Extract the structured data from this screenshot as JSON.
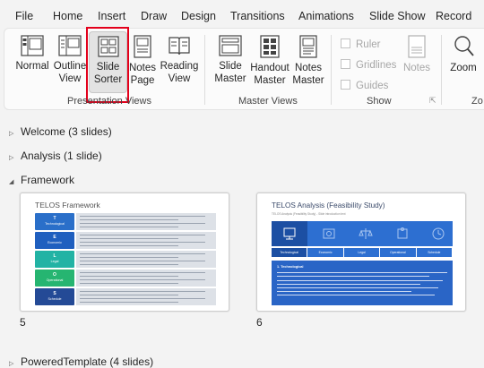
{
  "menu": [
    "File",
    "Home",
    "Insert",
    "Draw",
    "Design",
    "Transitions",
    "Animations",
    "Slide Show",
    "Record"
  ],
  "ribbon": {
    "presentation_views": {
      "label": "Presentation Views",
      "buttons": [
        {
          "line1": "Normal",
          "line2": ""
        },
        {
          "line1": "Outline",
          "line2": "View"
        },
        {
          "line1": "Slide",
          "line2": "Sorter"
        },
        {
          "line1": "Notes",
          "line2": "Page"
        },
        {
          "line1": "Reading",
          "line2": "View"
        }
      ]
    },
    "master_views": {
      "label": "Master Views",
      "buttons": [
        {
          "line1": "Slide",
          "line2": "Master"
        },
        {
          "line1": "Handout",
          "line2": "Master"
        },
        {
          "line1": "Notes",
          "line2": "Master"
        }
      ]
    },
    "show": {
      "label": "Show",
      "checkboxes": [
        "Ruler",
        "Gridlines",
        "Guides"
      ],
      "notes_button": "Notes"
    },
    "zoom": {
      "label": "Zoom",
      "group_label": "Zo"
    }
  },
  "sections": [
    {
      "title": "Welcome (3 slides)",
      "expanded": false
    },
    {
      "title": "Analysis (1 slide)",
      "expanded": false
    },
    {
      "title": "Framework",
      "expanded": true
    },
    {
      "title": "PoweredTemplate (4 slides)",
      "expanded": false
    }
  ],
  "slides": [
    {
      "number": "5",
      "title": "TELOS Framework",
      "rows": [
        {
          "letter": "T",
          "name": "Technological",
          "color": "#2a6fc9"
        },
        {
          "letter": "E",
          "name": "Economic",
          "color": "#1f5fbf"
        },
        {
          "letter": "L",
          "name": "Legal",
          "color": "#22b3a4"
        },
        {
          "letter": "O",
          "name": "Operational",
          "color": "#26b571"
        },
        {
          "letter": "S",
          "name": "Schedule",
          "color": "#244a96"
        }
      ]
    },
    {
      "number": "6",
      "title": "TELOS Analysis (Feasibility Study)",
      "subtitle": "TELOS Analysis (Feasibility Study) - Slide introduction text",
      "steps": [
        "Technological",
        "Economic",
        "Legal",
        "Operational",
        "Schedule"
      ],
      "section_heading": "1. Technological",
      "colors": {
        "dark": "#1c4fa3",
        "mid": "#2d6fd1",
        "panel": "#2a65c6"
      }
    }
  ]
}
